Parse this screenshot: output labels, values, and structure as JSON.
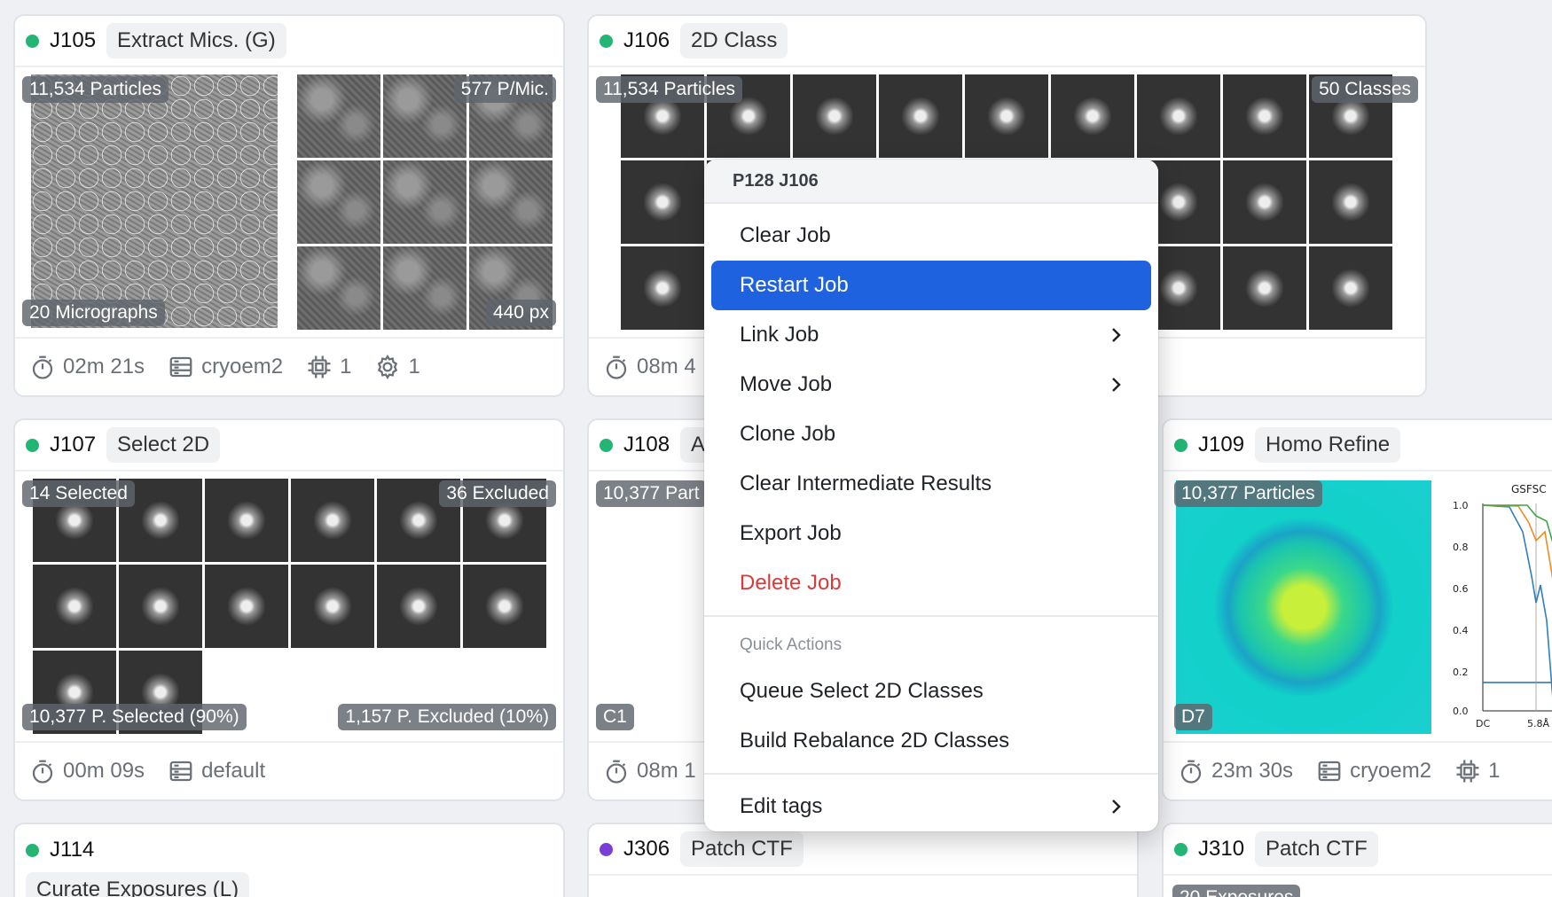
{
  "cards": {
    "j105": {
      "id": "J105",
      "type": "Extract Mics. (G)",
      "status_color": "#22b573",
      "badges": {
        "particles": "11,534 Particles",
        "per_mic": "577 P/Mic.",
        "micrographs": "20 Micrographs",
        "px": "440 px"
      },
      "footer": {
        "time": "02m 21s",
        "lane": "cryoem2",
        "gpus": "1",
        "threads": "1"
      }
    },
    "j106": {
      "id": "J106",
      "type": "2D Class",
      "status_color": "#22b573",
      "badges": {
        "particles": "11,534 Particles",
        "classes": "50 Classes"
      },
      "footer": {
        "time": "08m 4"
      }
    },
    "j107": {
      "id": "J107",
      "type": "Select 2D",
      "status_color": "#22b573",
      "badges": {
        "selected": "14 Selected",
        "excluded": "36 Excluded",
        "p_selected": "10,377 P. Selected (90%)",
        "p_excluded": "1,157 P. Excluded (10%)"
      },
      "footer": {
        "time": "00m 09s",
        "lane": "default"
      }
    },
    "j108": {
      "id": "J108",
      "type": "A",
      "status_color": "#22b573",
      "badges": {
        "particles": "10,377 Part",
        "sym": "C1"
      },
      "footer": {
        "time": "08m 1"
      }
    },
    "j109": {
      "id": "J109",
      "type": "Homo Refine",
      "status_color": "#22b573",
      "badges": {
        "particles": "10,377 Particles",
        "sym": "D7"
      },
      "plot": {
        "legend": "GSFSC",
        "y_ticks": [
          "1.0",
          "0.8",
          "0.6",
          "0.4",
          "0.2",
          "0.0"
        ],
        "x_ticks": [
          "DC",
          "5.8Å"
        ]
      },
      "footer": {
        "time": "23m 30s",
        "lane": "cryoem2",
        "gpus": "1"
      }
    },
    "j114": {
      "id": "J114",
      "type": "Curate Exposures (L)",
      "status_color": "#22b573"
    },
    "j306": {
      "id": "J306",
      "type": "Patch CTF",
      "status_color": "#7a3ed6"
    },
    "j310": {
      "id": "J310",
      "type": "Patch CTF",
      "status_color": "#22b573",
      "badges": {
        "exposures": "20 Exposures"
      }
    }
  },
  "context_menu": {
    "title": "P128 J106",
    "items": [
      "Clear Job",
      "Restart Job",
      "Link Job",
      "Move Job",
      "Clone Job",
      "Clear Intermediate Results",
      "Export Job",
      "Delete Job"
    ],
    "quick_label": "Quick Actions",
    "quick_items": [
      "Queue Select 2D Classes",
      "Build Rebalance 2D Classes"
    ],
    "edit_tags": "Edit tags",
    "active_color": "#1f62e0",
    "danger_color": "#d93a3a"
  }
}
